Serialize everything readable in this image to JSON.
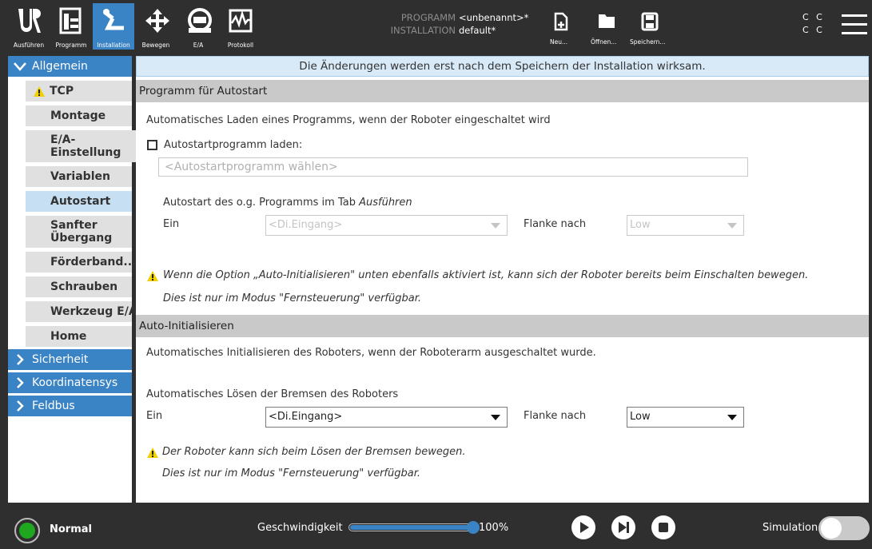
{
  "header": {
    "tabs": [
      {
        "label": "Ausführen",
        "icon": "ur-logo-icon"
      },
      {
        "label": "Programm",
        "icon": "program-icon"
      },
      {
        "label": "Installation",
        "icon": "installation-icon",
        "active": true
      },
      {
        "label": "Bewegen",
        "icon": "move-arrows-icon"
      },
      {
        "label": "E/A",
        "icon": "io-icon"
      },
      {
        "label": "Protokoll",
        "icon": "log-icon"
      }
    ],
    "program_key": "PROGRAMM",
    "program_value": "<unbenannt>*",
    "installation_key": "INSTALLATION",
    "installation_value": "default*",
    "file_buttons": [
      {
        "label": "Neu...",
        "icon": "new-file-icon"
      },
      {
        "label": "Öffnen...",
        "icon": "folder-icon"
      },
      {
        "label": "Speichern...",
        "icon": "save-icon"
      }
    ],
    "cc_top": "C C",
    "cc_bottom": "C C"
  },
  "sidebar": {
    "groups": [
      {
        "label": "Allgemein",
        "expanded": true
      },
      {
        "label": "Sicherheit"
      },
      {
        "label": "Koordinatensys"
      },
      {
        "label": "Feldbus"
      }
    ],
    "items": [
      {
        "label": "TCP",
        "warning": true
      },
      {
        "label": "Montage"
      },
      {
        "label": "E/A-Einstellung"
      },
      {
        "label": "Variablen"
      },
      {
        "label": "Autostart",
        "active": true
      },
      {
        "label": "Sanfter Übergang"
      },
      {
        "label": "Förderband..."
      },
      {
        "label": "Schrauben"
      },
      {
        "label": "Werkzeug E/A"
      },
      {
        "label": "Home"
      }
    ]
  },
  "main": {
    "notice": "Die Änderungen werden erst nach dem Speichern der Installation wirksam.",
    "autostart": {
      "title": "Programm für Autostart",
      "description": "Automatisches Laden eines Programms, wenn der Roboter eingeschaltet wird",
      "checkbox_label": "Autostartprogramm laden:",
      "checkbox_checked": false,
      "program_placeholder": "<Autostartprogramm wählen>",
      "tab_text": "Autostart des o.g. Programms im Tab ",
      "tab_name": "Ausführen",
      "on_label": "Ein",
      "input_value": "<Di.Eingang>",
      "flank_label": "Flanke nach",
      "flank_value": "Low",
      "warning_text": "Wenn die Option „Auto-Initialisieren\" unten ebenfalls aktiviert ist, kann sich der Roboter bereits beim Einschalten bewegen.",
      "mode_text": "Dies ist nur im Modus \"Fernsteuerung\" verfügbar."
    },
    "autoinit": {
      "title": "Auto-Initialisieren",
      "description": "Automatisches Initialisieren des Roboters, wenn der Roboterarm ausgeschaltet wurde.",
      "brake_label": "Automatisches Lösen der Bremsen des Roboters",
      "on_label": "Ein",
      "input_value": "<Di.Eingang>",
      "flank_label": "Flanke nach",
      "flank_value": "Low",
      "warning_text": "Der Roboter kann sich beim Lösen der Bremsen bewegen.",
      "mode_text": "Dies ist nur im Modus \"Fernsteuerung\" verfügbar."
    }
  },
  "footer": {
    "status": "Normal",
    "status_color": "#1fa81f",
    "speed_label": "Geschwindigkeit",
    "speed_fraction": 1.0,
    "speed_value": "100%",
    "simulation_label": "Simulation",
    "simulation_on": false
  },
  "colors": {
    "accent": "#3a84c6",
    "header_bg": "#2f2f2f",
    "warning": "#f0d000"
  }
}
